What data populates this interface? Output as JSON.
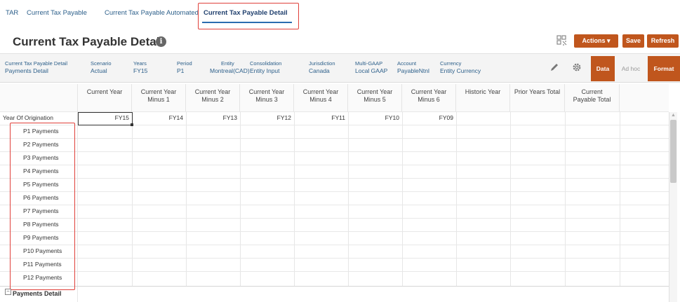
{
  "tabs": [
    {
      "label": "TAR"
    },
    {
      "label": "Current Tax Payable"
    },
    {
      "label": "Current Tax Payable Automated"
    },
    {
      "label": "Current Tax Payable Detail",
      "active": true
    }
  ],
  "page_title": "Current Tax Payable Detail",
  "toolbar": {
    "actions_label": "Actions",
    "save_label": "Save",
    "refresh_label": "Refresh"
  },
  "pov": [
    {
      "label": "Current Tax Payable Detail",
      "value": "Payments Detail"
    },
    {
      "label": "Scenario",
      "value": "Actual"
    },
    {
      "label": "Years",
      "value": "FY15"
    },
    {
      "label": "Period",
      "value": "P1"
    },
    {
      "label": "Entity",
      "value": "Montreal(CAD)"
    },
    {
      "label": "Consolidation",
      "value": "Entity Input"
    },
    {
      "label": "Jurisdiction",
      "value": "Canada"
    },
    {
      "label": "Multi-GAAP",
      "value": "Local GAAP"
    },
    {
      "label": "Account",
      "value": "PayableNtnl"
    },
    {
      "label": "Currency",
      "value": "Entity Currency"
    }
  ],
  "mode_buttons": {
    "data": "Data",
    "adhoc": "Ad hoc",
    "format": "Format"
  },
  "grid": {
    "columns": [
      "Current Year",
      "Current Year Minus 1",
      "Current Year Minus 2",
      "Current Year Minus 3",
      "Current Year Minus 4",
      "Current Year Minus 5",
      "Current Year Minus 6",
      "Historic Year",
      "Prior Years Total",
      "Current Payable Total"
    ],
    "origin_label": "Year Of Origination",
    "origin_values": [
      "FY15",
      "FY14",
      "FY13",
      "FY12",
      "FY11",
      "FY10",
      "FY09"
    ],
    "rows": [
      "P1 Payments",
      "P2 Payments",
      "P3 Payments",
      "P4 Payments",
      "P5 Payments",
      "P6 Payments",
      "P7 Payments",
      "P8 Payments",
      "P9 Payments",
      "P10 Payments",
      "P11 Payments",
      "P12 Payments"
    ],
    "section_label": "Payments Detail"
  },
  "colors": {
    "accent": "#c0561d",
    "highlight": "#e0403a",
    "link": "#2c5f8a"
  }
}
